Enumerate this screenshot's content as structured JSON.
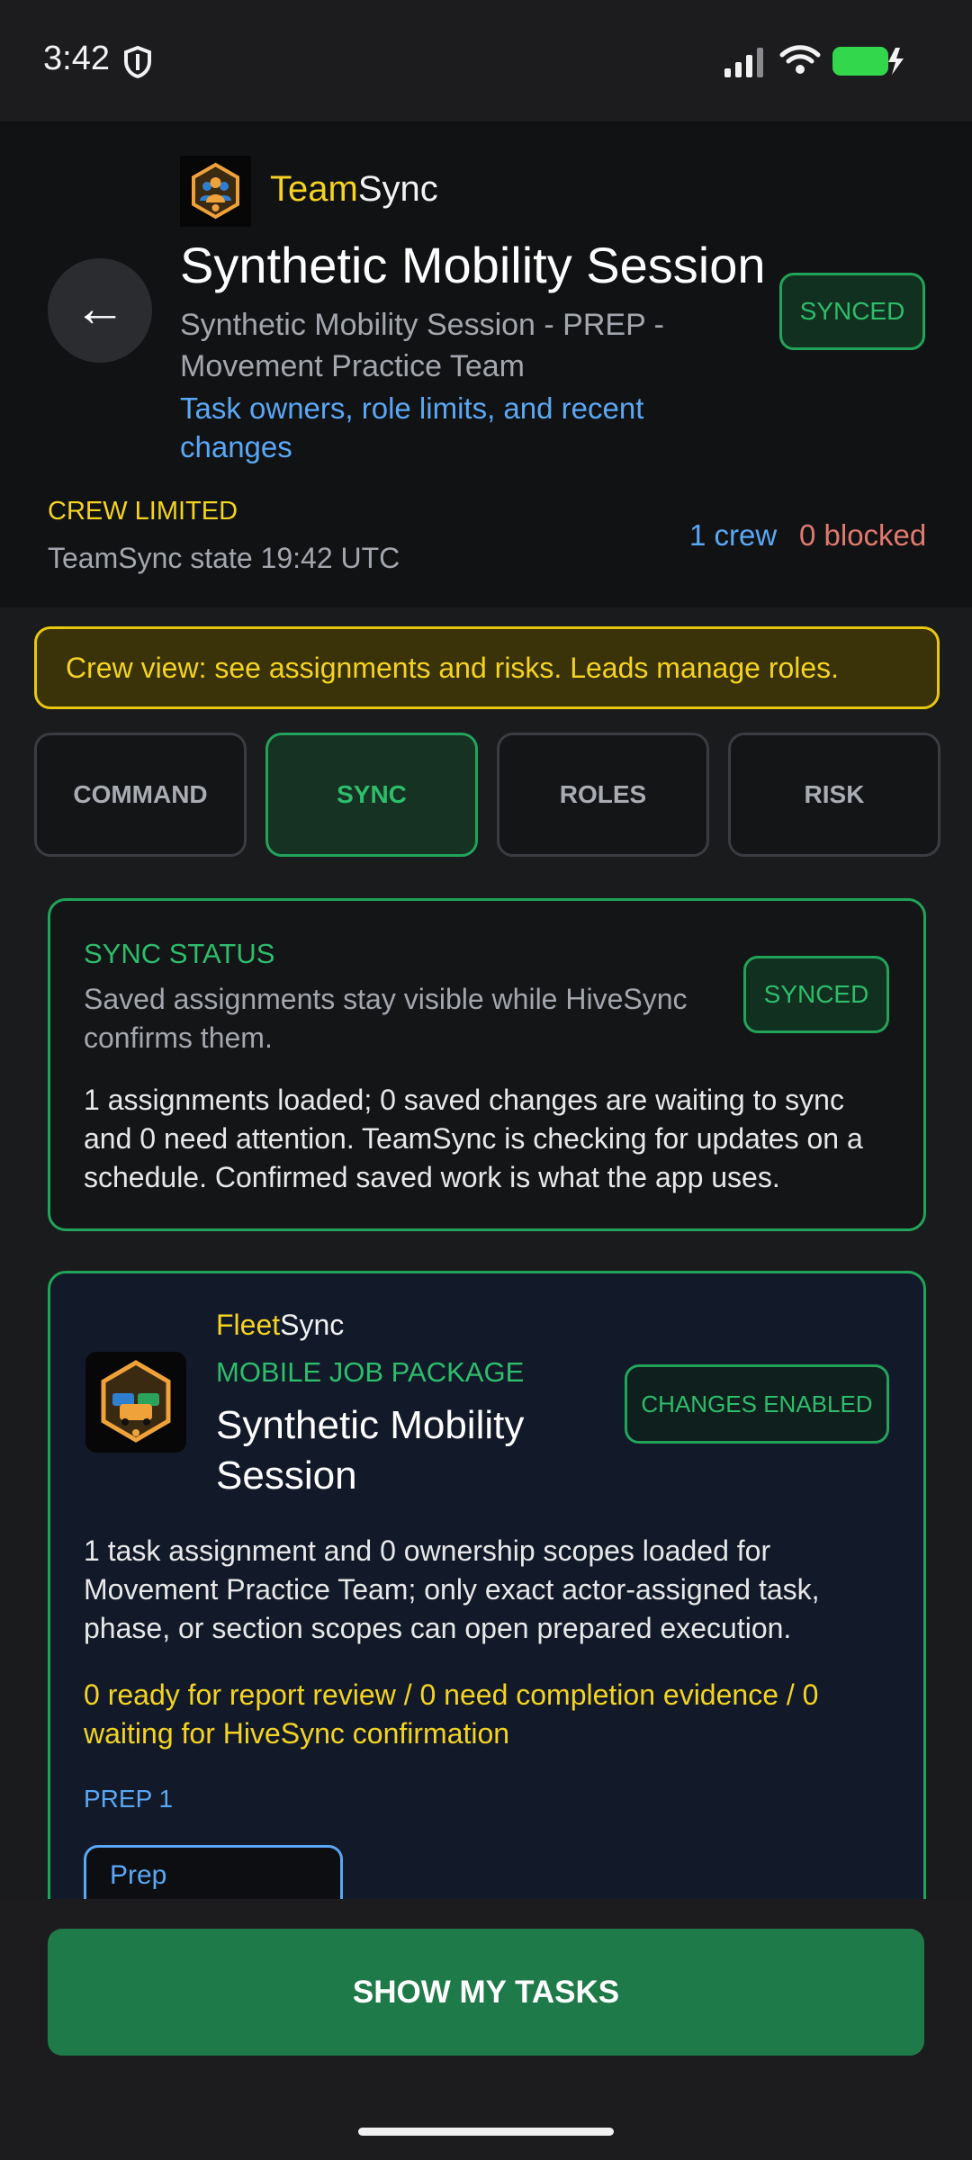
{
  "status_bar": {
    "time": "3:42"
  },
  "header": {
    "brand_part1": "Team",
    "brand_part2": "Sync",
    "title": "Synthetic Mobility Session",
    "subtitle": "Synthetic Mobility Session - PREP - Movement Practice Team",
    "link_text": "Task owners, role limits, and recent changes",
    "sync_badge": "SYNCED",
    "crew_limited": "CREW LIMITED",
    "state_text": "TeamSync state 19:42 UTC",
    "crew_count": "1 crew",
    "blocked_count": "0 blocked"
  },
  "notice": "Crew view: see assignments and risks. Leads manage roles.",
  "tabs": [
    {
      "label": "COMMAND"
    },
    {
      "label": "SYNC"
    },
    {
      "label": "ROLES"
    },
    {
      "label": "RISK"
    }
  ],
  "sync_card": {
    "title": "SYNC STATUS",
    "subtitle": "Saved assignments stay visible while HiveSync confirms them.",
    "badge": "SYNCED",
    "body": "1 assignments loaded; 0 saved changes are waiting to sync and 0 need attention. TeamSync is checking for updates on a schedule. Confirmed saved work is what the app uses."
  },
  "package_card": {
    "brand_part1": "Fleet",
    "brand_part2": "Sync",
    "kicker": "MOBILE JOB PACKAGE",
    "title": "Synthetic Mobility Session",
    "badge": "CHANGES ENABLED",
    "body": "1 task assignment and 0 ownership scopes loaded for Movement Practice Team; only exact actor-assigned task, phase, or section scopes can open prepared execution.",
    "warning": "0 ready for report review / 0 need completion evidence / 0 waiting for HiveSync confirmation",
    "section_label": "PREP 1",
    "chip_label": "Prep"
  },
  "cta": "SHOW MY TASKS",
  "colors": {
    "accent_green": "#22a35a",
    "brand_yellow": "#f4d322",
    "link_blue": "#5aa8f5",
    "danger": "#e07a70"
  }
}
